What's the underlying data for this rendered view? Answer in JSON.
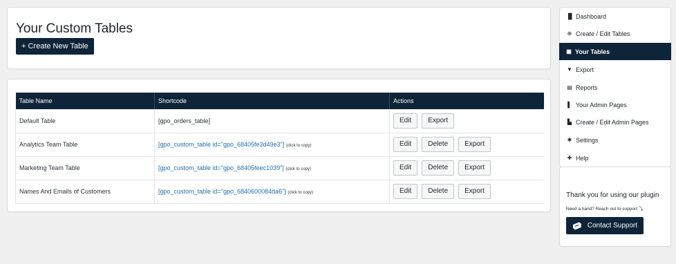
{
  "header": {
    "title": "Your Custom Tables",
    "create_button": "+ Create New Table"
  },
  "table": {
    "columns": [
      "Table Name",
      "Shortcode",
      "Actions"
    ],
    "rows": [
      {
        "name": "Default Table",
        "shortcode": "[gpo_orders_table]",
        "copy_hint": "",
        "actions": [
          "Edit",
          "Export"
        ]
      },
      {
        "name": "Analytics Team Table",
        "shortcode": "[gpo_custom_table id=\"gpo_68405fe3d49e3\"]",
        "copy_hint": "(click to copy)",
        "actions": [
          "Edit",
          "Delete",
          "Export"
        ]
      },
      {
        "name": "Marketing Team Table",
        "shortcode": "[gpo_custom_table id=\"gpo_68405feec1039\"]",
        "copy_hint": "(click to copy)",
        "actions": [
          "Edit",
          "Delete",
          "Export"
        ]
      },
      {
        "name": "Names And Emails of Customers",
        "shortcode": "[gpo_custom_table id=\"gpo_6840600084da6\"]",
        "copy_hint": "(click to copy)",
        "actions": [
          "Edit",
          "Delete",
          "Export"
        ]
      }
    ]
  },
  "sidebar": {
    "items": [
      {
        "label": "Dashboard",
        "icon": "bar-chart-icon"
      },
      {
        "label": "Create / Edit Tables",
        "icon": "plus-circle-icon"
      },
      {
        "label": "Your Tables",
        "icon": "table-icon",
        "active": true
      },
      {
        "label": "Export",
        "icon": "download-icon"
      },
      {
        "label": "Reports",
        "icon": "file-icon"
      },
      {
        "label": "Your Admin Pages",
        "icon": "page-icon"
      },
      {
        "label": "Create / Edit Admin Pages",
        "icon": "page-edit-icon"
      },
      {
        "label": "Settings",
        "icon": "gear-icon"
      },
      {
        "label": "Help",
        "icon": "help-icon"
      }
    ]
  },
  "support": {
    "thanks": "Thank you for using our plugin",
    "help": "Need a hand? Reach out to support ⤵",
    "button": "Contact Support"
  },
  "colors": {
    "primary": "#0e2438",
    "link": "#2271b1",
    "background": "#f0f0f1"
  }
}
